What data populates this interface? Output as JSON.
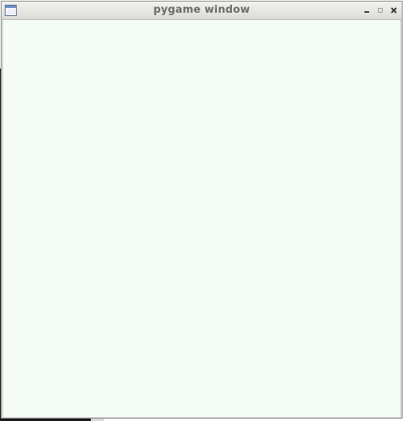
{
  "window": {
    "title": "pygame window",
    "icon": "app-window-icon",
    "controls": [
      "minimize-icon",
      "maximize-icon",
      "close-icon"
    ],
    "canvas_color": "#f5fcf8"
  }
}
